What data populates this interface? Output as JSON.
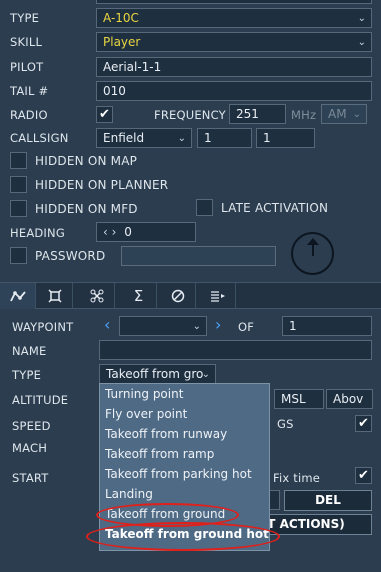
{
  "unit": {
    "type_label": "TYPE",
    "type_value": "A-10C",
    "skill_label": "SKILL",
    "skill_value": "Player",
    "pilot_label": "PILOT",
    "pilot_value": "Aerial-1-1",
    "tail_label": "TAIL #",
    "tail_value": "010",
    "radio_label": "RADIO",
    "radio_checked": "✔",
    "frequency_label": "FREQUENCY",
    "frequency_value": "251",
    "frequency_unit": "MHz",
    "modulation_value": "AM",
    "callsign_label": "CALLSIGN",
    "callsign_value": "Enfield",
    "callsign_num1": "1",
    "callsign_num2": "1",
    "hidden_map_label": "HIDDEN ON MAP",
    "hidden_planner_label": "HIDDEN ON PLANNER",
    "hidden_mfd_label": "HIDDEN ON MFD",
    "late_activation_label": "LATE ACTIVATION",
    "heading_label": "HEADING",
    "heading_arrows": "‹ ›",
    "heading_value": "0",
    "password_label": "PASSWORD",
    "password_value": ""
  },
  "tabs": [
    {
      "icon": "route-icon"
    },
    {
      "icon": "target-icon"
    },
    {
      "icon": "payload-icon"
    },
    {
      "icon": "summary-icon"
    },
    {
      "icon": "failures-icon"
    },
    {
      "icon": "briefing-icon"
    }
  ],
  "waypoint": {
    "waypoint_label": "WAYPOINT",
    "of_label": "OF",
    "of_value": "1",
    "name_label": "NAME",
    "name_value": "",
    "type_label": "TYPE",
    "type_value": "Takeoff from gro",
    "altitude_label": "ALTITUDE",
    "altitude_ref": "MSL",
    "altitude_mode": "Abov",
    "speed_label": "SPEED",
    "speed_mode": "GS",
    "speed_checked": "✔",
    "mach_label": "MACH",
    "start_label": "START",
    "fix_time_label": "Fix time",
    "fix_time_checked": "✔",
    "del_button": "DEL",
    "actions_button": "T ACTIONS)"
  },
  "type_dropdown_options": [
    "Turning point",
    "Fly over point",
    "Takeoff from runway",
    "Takeoff from ramp",
    "Takeoff from parking hot",
    "Landing",
    "Takeoff from ground",
    "Takeoff from ground hot"
  ],
  "colors": {
    "background": "#2b3d4f",
    "field": "#1e2f40",
    "accent_yellow": "#e9d640",
    "nav_blue": "#4fa3ff",
    "highlight_ring": "#e0201a",
    "popup": "#4f6a85"
  }
}
